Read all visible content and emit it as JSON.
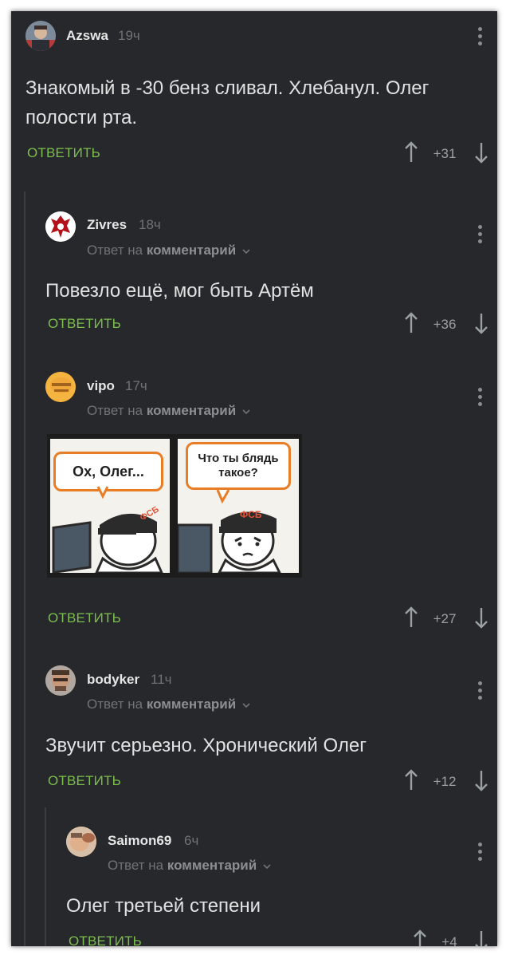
{
  "comments": [
    {
      "username": "Azswa",
      "time": "19ч",
      "text": "Знакомый в -30 бенз сливал. Хлебанул. Олег полости рта.",
      "reply_label": "ОТВЕТИТЬ",
      "score": "+31"
    },
    {
      "username": "Zivres",
      "time": "18ч",
      "reply_prefix": "Ответ на",
      "reply_target": "комментарий",
      "text": "Повезло ещё, мог быть Артём",
      "reply_label": "ОТВЕТИТЬ",
      "score": "+36"
    },
    {
      "username": "vipo",
      "time": "17ч",
      "reply_prefix": "Ответ на",
      "reply_target": "комментарий",
      "image": {
        "left_bubble": "Ох, Олег...",
        "right_bubble": "Что ты блядь такое?",
        "cap_label": "ФСБ"
      },
      "reply_label": "ОТВЕТИТЬ",
      "score": "+27"
    },
    {
      "username": "bodyker",
      "time": "11ч",
      "reply_prefix": "Ответ на",
      "reply_target": "комментарий",
      "text": "Звучит серьезно. Хронический Олег",
      "reply_label": "ОТВЕТИТЬ",
      "score": "+12"
    },
    {
      "username": "Saimon69",
      "time": "6ч",
      "reply_prefix": "Ответ на",
      "reply_target": "комментарий",
      "text": "Олег третьей степени",
      "reply_label": "ОТВЕТИТЬ",
      "score": "+4"
    }
  ],
  "colors": {
    "background": "#26282b",
    "reply_green": "#7cbf4c",
    "meta_gray": "#6f7377",
    "text": "#e2e2e2"
  },
  "icons": [
    "more-vertical-icon",
    "upvote-arrow-icon",
    "downvote-arrow-icon",
    "chevron-down-icon"
  ]
}
